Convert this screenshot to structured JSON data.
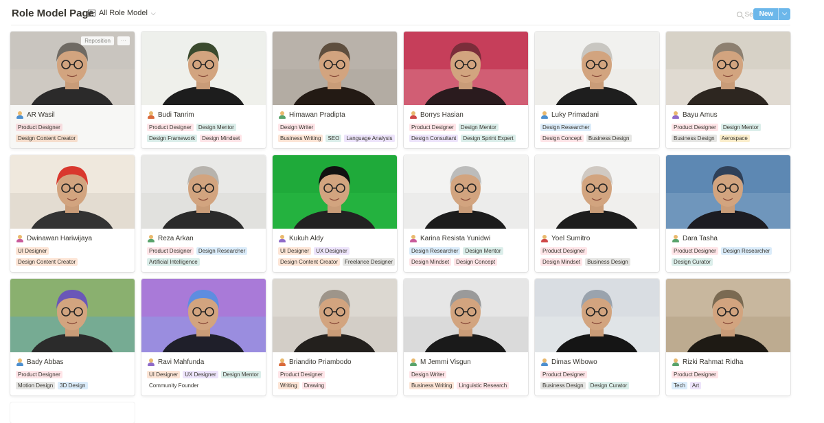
{
  "header": {
    "title": "Role Model Page",
    "view_label": "All Role Model",
    "search_label": "Search",
    "new_label": "New"
  },
  "cover_controls": {
    "reposition_label": "Reposition",
    "more_label": "···"
  },
  "colors": {
    "accent": "#6cb7ea",
    "tag_red": "rgba(255,0,26,0.1)",
    "tag_orange": "rgba(245,93,0,0.16)",
    "tag_green": "rgba(0,135,107,0.14)",
    "tag_blue": "rgba(0,120,223,0.14)",
    "tag_purple": "rgba(103,36,222,0.12)",
    "tag_gray": "rgba(206,205,202,0.5)",
    "tag_yellow": "rgba(233,168,0,0.2)"
  },
  "cards": [
    {
      "name": "AR Wasil",
      "icon": "person-icon",
      "rows": [
        [
          {
            "t": "Product Designer",
            "c": "red"
          }
        ],
        [
          {
            "t": "Design Content Creator",
            "c": "orange"
          }
        ]
      ]
    },
    {
      "name": "Budi Tanrim",
      "icon": "person-icon",
      "rows": [
        [
          {
            "t": "Product Designer",
            "c": "red"
          },
          {
            "t": "Design Mentor",
            "c": "green"
          }
        ],
        [
          {
            "t": "Design Framework",
            "c": "green"
          },
          {
            "t": "Design Mindset",
            "c": "red"
          }
        ]
      ]
    },
    {
      "name": "Himawan Pradipta",
      "icon": "person-icon",
      "rows": [
        [
          {
            "t": "Design Writer",
            "c": "red"
          }
        ],
        [
          {
            "t": "Business Writing",
            "c": "orange"
          },
          {
            "t": "SEO",
            "c": "green"
          },
          {
            "t": "Language Analysis",
            "c": "purple"
          }
        ]
      ]
    },
    {
      "name": "Borrys Hasian",
      "icon": "person-icon",
      "rows": [
        [
          {
            "t": "Product Designer",
            "c": "red"
          },
          {
            "t": "Design Mentor",
            "c": "green"
          }
        ],
        [
          {
            "t": "Design Consultant",
            "c": "purple"
          },
          {
            "t": "Design Sprint Expert",
            "c": "green"
          }
        ]
      ]
    },
    {
      "name": "Luky Primadani",
      "icon": "person-icon",
      "rows": [
        [
          {
            "t": "Design Researcher",
            "c": "blue"
          }
        ],
        [
          {
            "t": "Design Concept",
            "c": "red"
          },
          {
            "t": "Business Design",
            "c": "gray"
          }
        ]
      ]
    },
    {
      "name": "Bayu Amus",
      "icon": "person-icon",
      "rows": [
        [
          {
            "t": "Product Designer",
            "c": "red"
          },
          {
            "t": "Design Mentor",
            "c": "green"
          }
        ],
        [
          {
            "t": "Business Design",
            "c": "gray"
          },
          {
            "t": "Aerospace",
            "c": "yellow"
          }
        ]
      ]
    },
    {
      "name": "Dwinawan Hariwijaya",
      "icon": "person-icon",
      "rows": [
        [
          {
            "t": "UI Designer",
            "c": "orange"
          }
        ],
        [
          {
            "t": "Design Content Creator",
            "c": "orange"
          }
        ]
      ]
    },
    {
      "name": "Reza Arkan",
      "icon": "person-icon",
      "rows": [
        [
          {
            "t": "Product Designer",
            "c": "red"
          },
          {
            "t": "Design Researcher",
            "c": "blue"
          }
        ],
        [
          {
            "t": "Artificial Intelligence",
            "c": "green"
          }
        ]
      ]
    },
    {
      "name": "Kukuh Aldy",
      "icon": "person-icon",
      "rows": [
        [
          {
            "t": "UI Designer",
            "c": "orange"
          },
          {
            "t": "UX Designer",
            "c": "purple"
          }
        ],
        [
          {
            "t": "Design Content Creator",
            "c": "orange"
          },
          {
            "t": "Freelance Designer",
            "c": "gray"
          }
        ]
      ]
    },
    {
      "name": "Karina Resista Yunidwi",
      "icon": "person-icon",
      "rows": [
        [
          {
            "t": "Design Researcher",
            "c": "blue"
          },
          {
            "t": "Design Mentor",
            "c": "green"
          }
        ],
        [
          {
            "t": "Design Mindset",
            "c": "red"
          },
          {
            "t": "Design Concept",
            "c": "red"
          }
        ]
      ]
    },
    {
      "name": "Yoel Sumitro",
      "icon": "person-icon",
      "rows": [
        [
          {
            "t": "Product Designer",
            "c": "red"
          }
        ],
        [
          {
            "t": "Design Mindset",
            "c": "red"
          },
          {
            "t": "Business Design",
            "c": "gray"
          }
        ]
      ]
    },
    {
      "name": "Dara Tasha",
      "icon": "person-icon",
      "rows": [
        [
          {
            "t": "Product Designer",
            "c": "red"
          },
          {
            "t": "Design Researcher",
            "c": "blue"
          }
        ],
        [
          {
            "t": "Design Curator",
            "c": "green"
          }
        ]
      ]
    },
    {
      "name": "Bady Abbas",
      "icon": "person-icon",
      "rows": [
        [
          {
            "t": "Product Designer",
            "c": "red"
          }
        ],
        [
          {
            "t": "Motion Design",
            "c": "gray"
          },
          {
            "t": "3D Design",
            "c": "blue"
          }
        ]
      ]
    },
    {
      "name": "Ravi Mahfunda",
      "icon": "person-icon",
      "rows": [
        [
          {
            "t": "UI Designer",
            "c": "orange"
          },
          {
            "t": "UX Designer",
            "c": "purple"
          },
          {
            "t": "Design Mentor",
            "c": "green"
          }
        ],
        [
          {
            "t": "Community Founder",
            "c": "none"
          }
        ]
      ]
    },
    {
      "name": "Briandito Priambodo",
      "icon": "person-icon",
      "rows": [
        [
          {
            "t": "Product Designer",
            "c": "red"
          }
        ],
        [
          {
            "t": "Writing",
            "c": "orange"
          },
          {
            "t": "Drawing",
            "c": "red"
          }
        ]
      ]
    },
    {
      "name": "M Jemmi Visgun",
      "icon": "person-icon",
      "rows": [
        [
          {
            "t": "Design Writer",
            "c": "red"
          }
        ],
        [
          {
            "t": "Business Writing",
            "c": "orange"
          },
          {
            "t": "Linguistic Research",
            "c": "red"
          }
        ]
      ]
    },
    {
      "name": "Dimas Wibowo",
      "icon": "person-icon",
      "rows": [
        [
          {
            "t": "Product Designer",
            "c": "red"
          }
        ],
        [
          {
            "t": "Business Design",
            "c": "gray"
          },
          {
            "t": "Design Curator",
            "c": "green"
          }
        ]
      ]
    },
    {
      "name": "Rizki Rahmat Ridha",
      "icon": "person-icon",
      "rows": [
        [
          {
            "t": "Product Designer",
            "c": "red"
          }
        ],
        [
          {
            "t": "Tech",
            "c": "blue"
          },
          {
            "t": "Art",
            "c": "purple"
          }
        ]
      ]
    }
  ]
}
